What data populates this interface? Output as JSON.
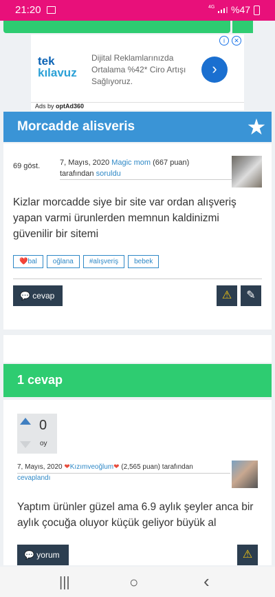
{
  "status": {
    "time": "21:20",
    "net": "4G",
    "battery": "%47"
  },
  "ad": {
    "logo_top": "tek",
    "logo_bottom": "kılavuz",
    "text": "Dijital Reklamlarınızda Ortalama %42* Ciro Artışı Sağlıyoruz.",
    "ads_by": "Ads by",
    "ads_provider": "optAd360",
    "go_glyph": "›",
    "info_glyph": "i",
    "close_glyph": "✕"
  },
  "question": {
    "title": "Morcadde alisveris",
    "views": "69 göst.",
    "date": "7, Mayıs, 2020",
    "author": "Magic mom",
    "points": "(667 puan)",
    "by": "tarafından",
    "action": "soruldu",
    "body": "Kizlar morcadde siye bir site var ordan alışveriş yapan varmi ürunlerden memnun kaldinizmi güvenilir bir sitemi",
    "tags": [
      "❤️bal",
      "oğlana",
      "#alışveriş",
      "bebek"
    ],
    "answer_button": "cevap"
  },
  "answers": {
    "count_label": "1 cevap",
    "items": [
      {
        "votes": "0",
        "votes_label": "oy",
        "date": "7, Mayıs, 2020",
        "author_heart": "❤️",
        "author": "Kızımveoğlum",
        "points": "(2,565 puan)",
        "by": "tarafından",
        "action": "cevaplandı",
        "body": "Yaptım ürünler güzel ama 6.9 aylık şeyler anca bir aylık çocuğa oluyor küçük geliyor büyük al",
        "comment_button": "yorum"
      }
    ]
  },
  "nav": {
    "recent": "|||",
    "home": "○",
    "back": "‹"
  },
  "colors": {
    "accent_blue": "#3a94d6",
    "accent_green": "#2ecc71",
    "status_pink": "#e8107a",
    "dark_button": "#2c3e50"
  }
}
